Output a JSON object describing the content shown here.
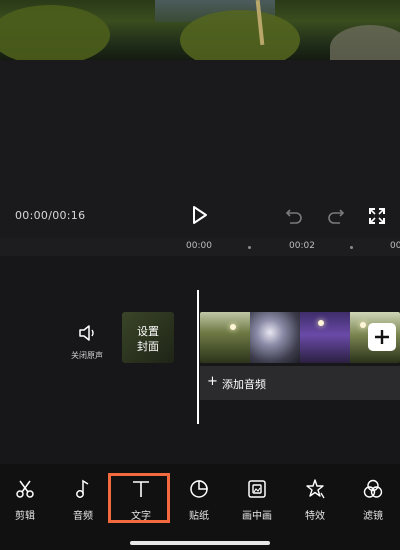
{
  "player": {
    "time": "00:00/00:16"
  },
  "timeline": {
    "ruler": [
      "00:00",
      "00:02",
      "00"
    ],
    "mute_label": "关闭原声",
    "cover_label_line1": "设置",
    "cover_label_line2": "封面",
    "add_audio_label": "添加音频",
    "add_audio_plus": "+"
  },
  "toolbar": {
    "items": [
      {
        "label": "剪辑",
        "icon": "scissors-icon"
      },
      {
        "label": "音频",
        "icon": "music-note-icon"
      },
      {
        "label": "文字",
        "icon": "text-icon"
      },
      {
        "label": "贴纸",
        "icon": "sticker-icon"
      },
      {
        "label": "画中画",
        "icon": "picture-in-picture-icon"
      },
      {
        "label": "特效",
        "icon": "effects-star-icon"
      },
      {
        "label": "滤镜",
        "icon": "filter-icon"
      }
    ],
    "active_index": 2
  },
  "colors": {
    "highlight": "#f26a3d",
    "background": "#1d1d1f"
  }
}
